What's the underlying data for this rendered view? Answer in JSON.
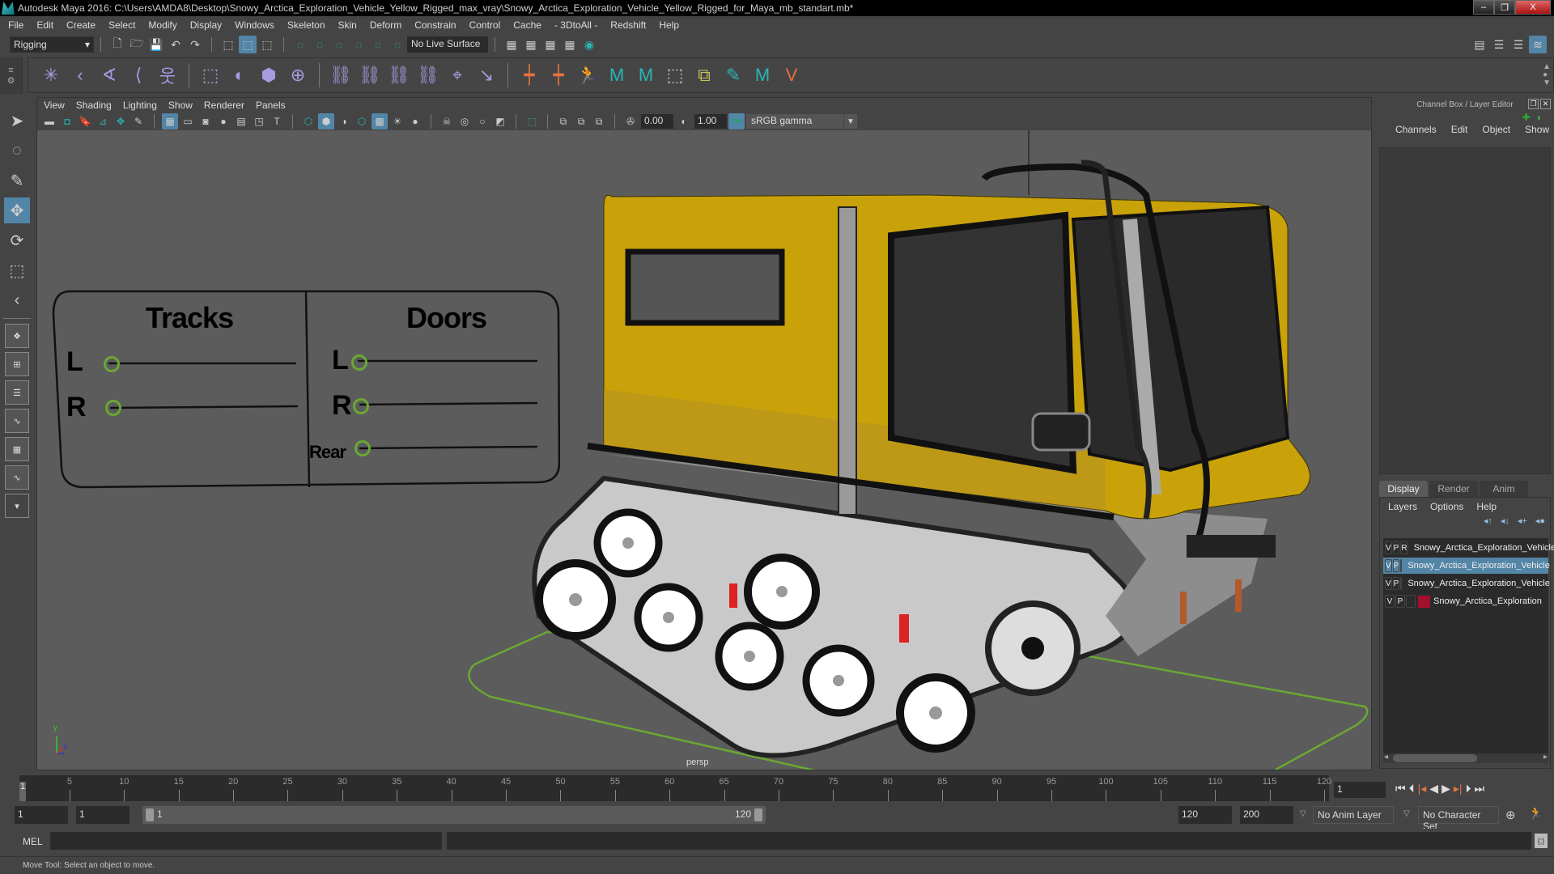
{
  "window": {
    "title": "Autodesk Maya 2016: C:\\Users\\AMDA8\\Desktop\\Snowy_Arctica_Exploration_Vehicle_Yellow_Rigged_max_vray\\Snowy_Arctica_Exploration_Vehicle_Yellow_Rigged_for_Maya_mb_standart.mb*",
    "minimize": "–",
    "restore": "❐",
    "close": "X"
  },
  "menubar": [
    "File",
    "Edit",
    "Create",
    "Select",
    "Modify",
    "Display",
    "Windows",
    "Skeleton",
    "Skin",
    "Deform",
    "Constrain",
    "Control",
    "Cache",
    "- 3DtoAll -",
    "Redshift",
    "Help"
  ],
  "status_line": {
    "menu_set": "Rigging",
    "live_surface": "No Live Surface"
  },
  "shelf": {
    "icons": [
      "joint-tool",
      "ik-handle",
      "ik-spline",
      "mirror-joint",
      "humanik",
      "bind-skin",
      "smooth-bind",
      "lattice",
      "cluster",
      "parent-constraint",
      "point-constraint",
      "orient-constraint",
      "scale-constraint",
      "aim-constraint",
      "pole-vector",
      "set-driven-key",
      "blend-shape",
      "character",
      "maya-logo",
      "maya-logo",
      "display-layer",
      "paint-weights",
      "maya-logo",
      "v-icon"
    ]
  },
  "viewport": {
    "menu": [
      "View",
      "Shading",
      "Lighting",
      "Show",
      "Renderer",
      "Panels"
    ],
    "exposure": "0.00",
    "gamma": "1.00",
    "color_mgmt": "ON",
    "color_space": "sRGB gamma",
    "camera_label": "persp",
    "axis": {
      "y": "y",
      "z": "z"
    }
  },
  "rig_panel": {
    "sections": [
      {
        "title": "Tracks",
        "controls": [
          "L",
          "R"
        ]
      },
      {
        "title": "Doors",
        "controls": [
          "L",
          "R",
          "Rear"
        ]
      }
    ]
  },
  "channel_box": {
    "title": "Channel Box / Layer Editor",
    "menu": [
      "Channels",
      "Edit",
      "Object",
      "Show"
    ]
  },
  "layer_editor": {
    "tabs": [
      "Display",
      "Render",
      "Anim"
    ],
    "active_tab": "Display",
    "menu": [
      "Layers",
      "Options",
      "Help"
    ],
    "layers": [
      {
        "v": "V",
        "p": "P",
        "r": "R",
        "color": "#0d4a22",
        "name": "Snowy_Arctica_Exploration_Vehicle",
        "selected": false
      },
      {
        "v": "V",
        "p": "P",
        "r": "",
        "color": "#0016ff",
        "name": "Snowy_Arctica_Exploration_Vehicle",
        "selected": true
      },
      {
        "v": "V",
        "p": "P",
        "r": "",
        "color": "#6aa833",
        "name": "Snowy_Arctica_Exploration_Vehicle",
        "selected": false
      },
      {
        "v": "V",
        "p": "P",
        "r": "",
        "color": "#a5102d",
        "name": "Snowy_Arctica_Exploration",
        "selected": false
      }
    ]
  },
  "timeline": {
    "ticks": [
      5,
      10,
      15,
      20,
      25,
      30,
      35,
      40,
      45,
      50,
      55,
      60,
      65,
      70,
      75,
      80,
      85,
      90,
      95,
      100,
      105,
      110,
      115,
      120
    ],
    "start": 1,
    "end": 120,
    "current_frame": "1",
    "current_frame_field": "1"
  },
  "range": {
    "start_field": "1",
    "playback_start": "1",
    "slider_start": "1",
    "slider_end": "120",
    "playback_end": "120",
    "end_field": "200",
    "anim_layer": "No Anim Layer",
    "character_set": "No Character Set"
  },
  "command_line": {
    "label": "MEL"
  },
  "help_line": "Move Tool: Select an object to move.",
  "colors": {
    "accent": "#5285a6",
    "control_curve": "#6aa833"
  }
}
